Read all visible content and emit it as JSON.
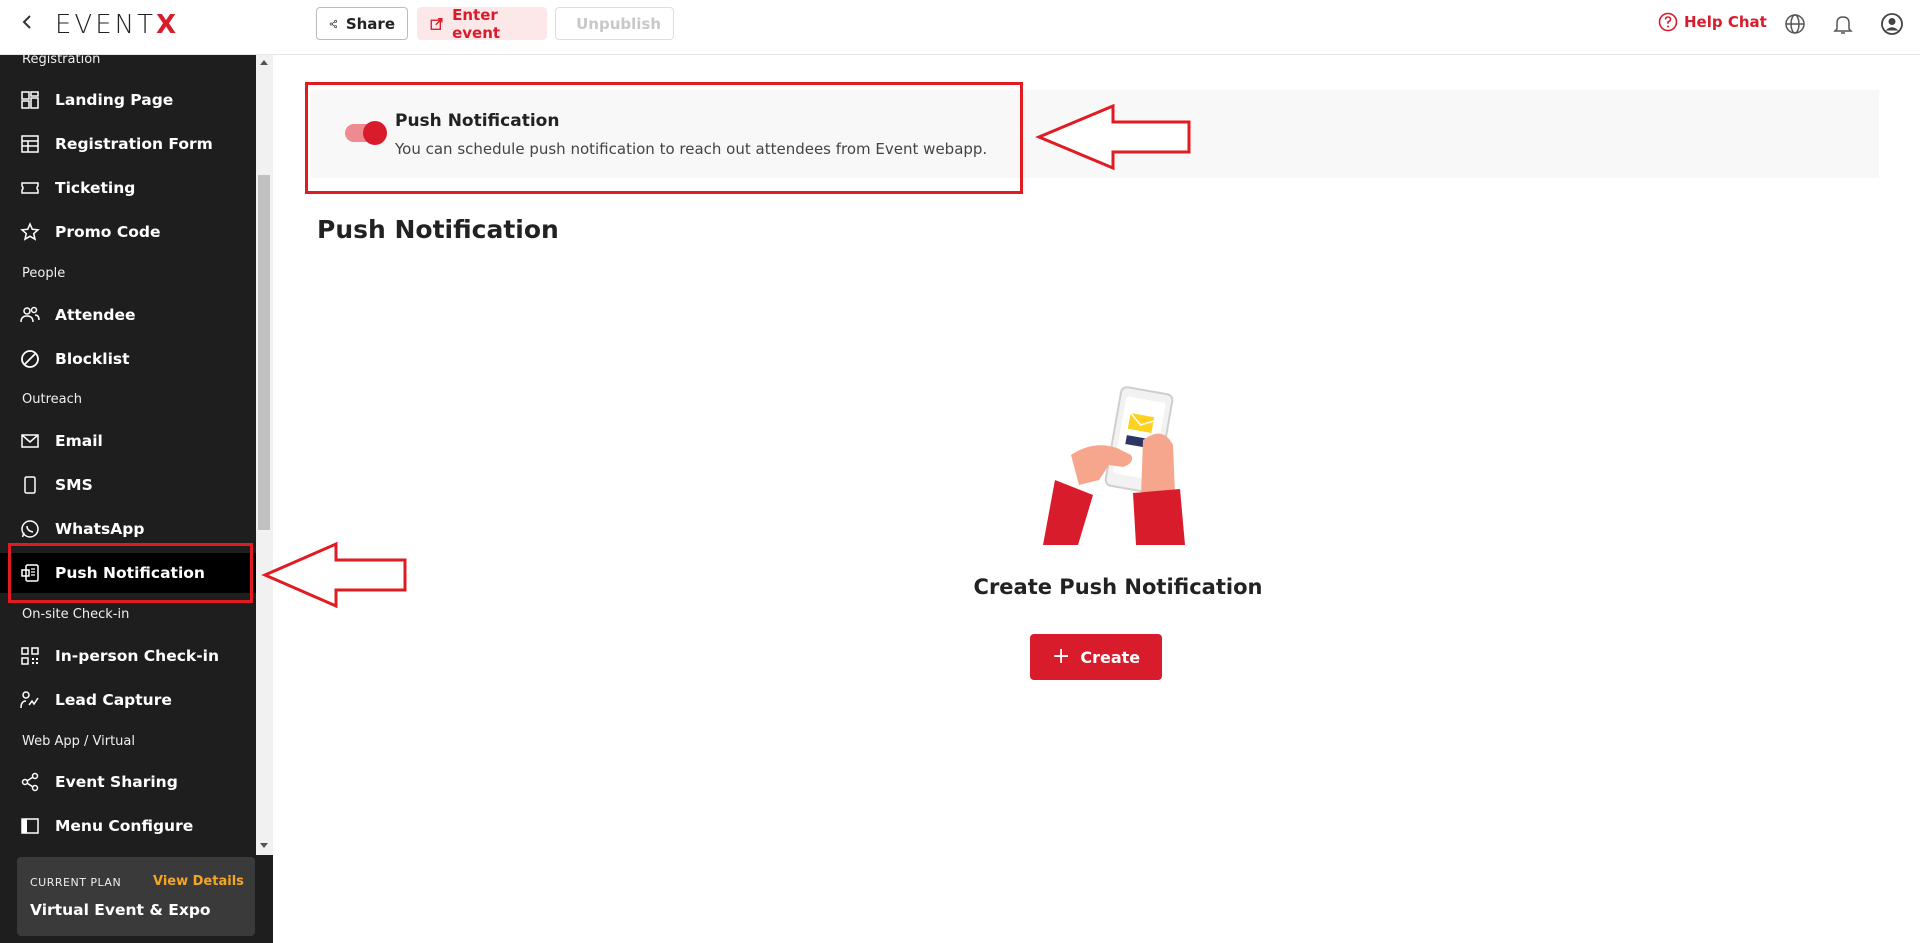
{
  "topbar": {
    "back_icon": "chevron-left-icon",
    "logo": {
      "text_main": "EVENT",
      "text_accent": "X"
    },
    "share_label": "Share",
    "enter_label": "Enter event",
    "unpublish_label": "Unpublish",
    "help_label": "Help Chat",
    "icons": [
      "globe-icon",
      "bell-icon",
      "user-avatar-icon"
    ]
  },
  "sidebar": {
    "sections": {
      "registration": "Registration",
      "people": "People",
      "outreach": "Outreach",
      "onsite": "On-site Check-in",
      "webapp": "Web App / Virtual"
    },
    "items": {
      "landing": "Landing Page",
      "regform": "Registration Form",
      "ticketing": "Ticketing",
      "promo": "Promo Code",
      "attendee": "Attendee",
      "blocklist": "Blocklist",
      "email": "Email",
      "sms": "SMS",
      "whatsapp": "WhatsApp",
      "push": "Push Notification",
      "checkin": "In-person Check-in",
      "lead": "Lead Capture",
      "sharing": "Event Sharing",
      "menu": "Menu Configure"
    },
    "active_item": "Push Notification",
    "plan": {
      "label": "CURRENT PLAN",
      "view_details": "View Details",
      "name": "Virtual Event & Expo"
    }
  },
  "main": {
    "banner": {
      "toggle_on": true,
      "title": "Push Notification",
      "description": "You can schedule push notification to reach out attendees from Event webapp."
    },
    "page_title": "Push Notification",
    "empty_state": {
      "illustration": "phone-notification-illustration",
      "title": "Create Push Notification",
      "button_label": "Create"
    }
  },
  "colors": {
    "accent": "#d81c2b",
    "sidebar_bg": "#1e1e1e",
    "highlight": "#e11b22",
    "plan_link": "#f5a623"
  }
}
